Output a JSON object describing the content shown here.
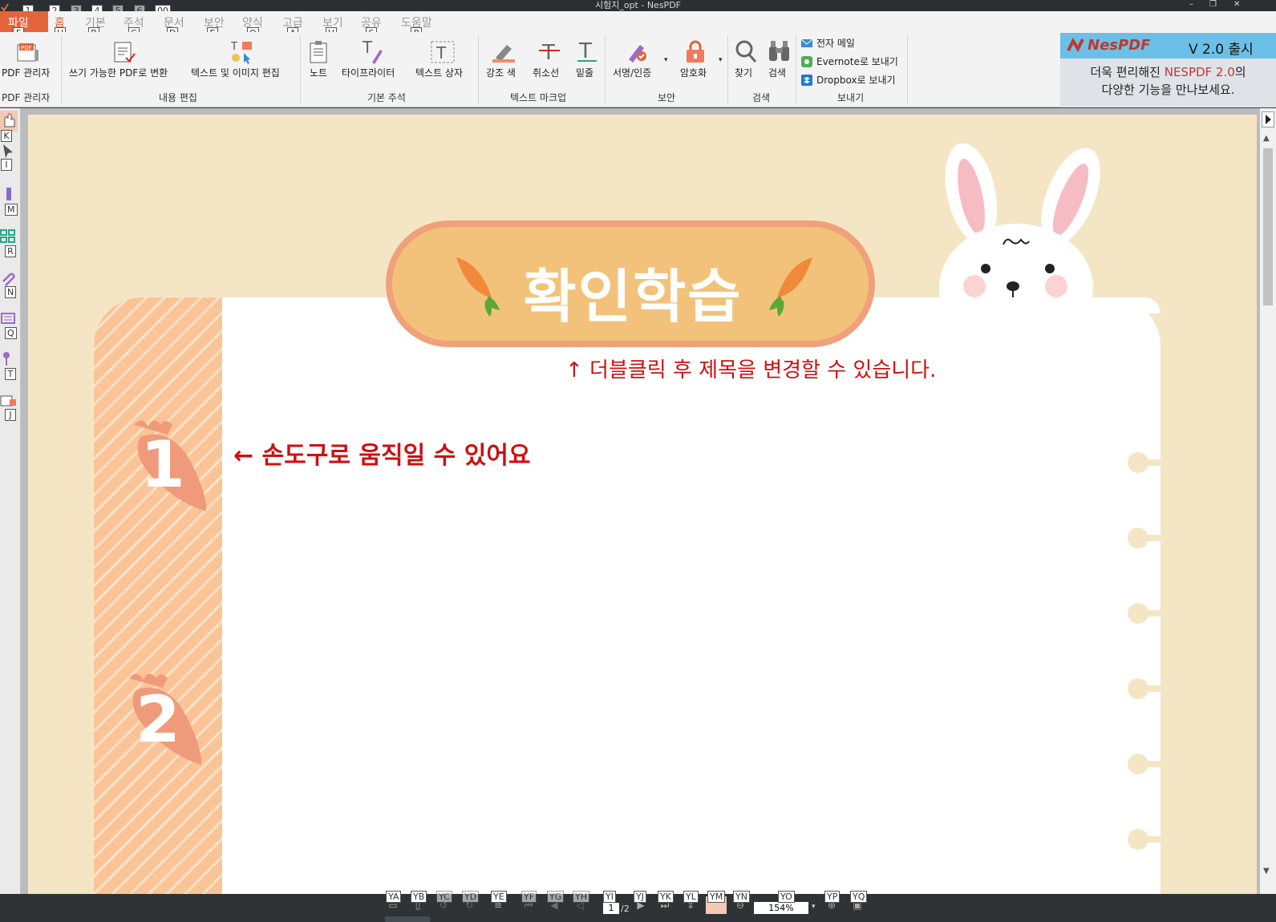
{
  "window": {
    "title": "시험지_opt - NesPDF",
    "controls": [
      "–",
      "❐",
      "✕"
    ]
  },
  "quick_access": {
    "keytips": [
      "1",
      "2",
      "3",
      "4",
      "5",
      "6",
      "00"
    ]
  },
  "menu": {
    "file": "파일",
    "file_keytip": "F",
    "items": [
      {
        "label": "홈",
        "keytip": "H"
      },
      {
        "label": "기본",
        "keytip": "B"
      },
      {
        "label": "주석",
        "keytip": "C"
      },
      {
        "label": "문서",
        "keytip": "D"
      },
      {
        "label": "보안",
        "keytip": "E"
      },
      {
        "label": "양식",
        "keytip": "O"
      },
      {
        "label": "고급",
        "keytip": "A"
      },
      {
        "label": "보기",
        "keytip": "V"
      },
      {
        "label": "공유",
        "keytip": "S"
      },
      {
        "label": "도움말",
        "keytip": "P"
      }
    ]
  },
  "ribbon": {
    "pdf_manager": "PDF 관리자",
    "pdf_manager_group": "PDF 관리자",
    "convert_writable": "쓰기 가능한 PDF로 변환",
    "edit_text_image": "텍스트 및 이미지 편집",
    "content_edit_group": "내용 편집",
    "note": "노트",
    "typewriter": "타이프라이터",
    "textbox": "텍스트 상자",
    "basic_annot_group": "기본 주석",
    "highlight": "강조 색",
    "strikeout": "취소선",
    "underline": "밑줄",
    "text_markup_group": "텍스트 마크업",
    "sign": "서명/인증",
    "encrypt": "암호화",
    "security_group": "보안",
    "find": "찾기",
    "search": "검색",
    "search_group": "검색",
    "email": "전자 메일",
    "evernote": "Evernote로 보내기",
    "dropbox": "Dropbox로 보내기",
    "send_group": "보내기"
  },
  "ad": {
    "brand": "NesPDF",
    "version": "V 2.0 출시",
    "line1_pre": "더욱 편리해진 ",
    "line1_highlight": "NESPDF 2.0",
    "line1_post": "의",
    "line2": "다양한 기능을 만나보세요."
  },
  "left_tools": {
    "keytips": [
      "K",
      "I",
      "M",
      "R",
      "N",
      "Q",
      "T",
      "J"
    ]
  },
  "document": {
    "title": "확인학습",
    "title_hint": "↑  더블클릭 후 제목을 변경할 수 있습니다.",
    "hand_hint": "← 손도구로 움직일 수 있어요",
    "number_1": "1",
    "number_2": "2"
  },
  "status": {
    "keytips": [
      "YA",
      "YB",
      "YC",
      "YD",
      "YE",
      "YF",
      "YG",
      "YH",
      "YI",
      "YJ",
      "YK",
      "YL",
      "YM",
      "YN",
      "YO",
      "YP",
      "YQ"
    ],
    "page_current": "1",
    "page_total": "/2",
    "zoom": "154%"
  },
  "colors": {
    "accent_orange": "#e4643c",
    "page_bg": "#f4e6c4",
    "hint_red": "#cc1111",
    "badge_orange": "#f3c27a",
    "badge_border": "#f0a07a",
    "stripe": "#fbc497",
    "carrot_number": "#ef9a7a"
  }
}
